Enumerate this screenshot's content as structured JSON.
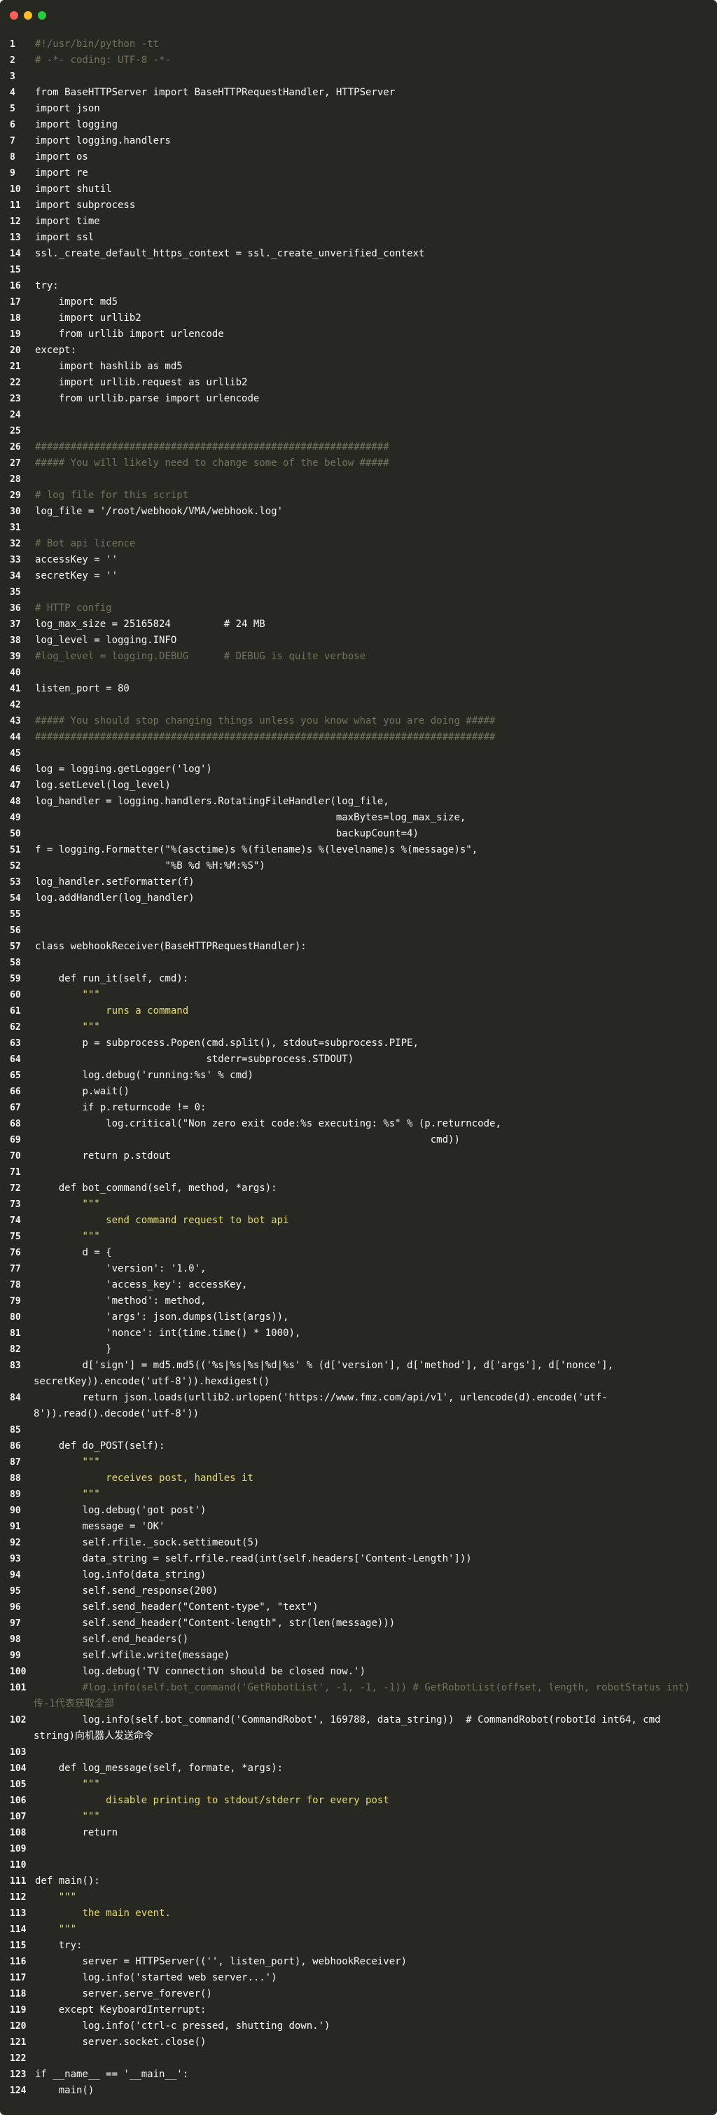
{
  "window": {
    "buttons": [
      "close",
      "minimize",
      "maximize"
    ]
  },
  "code": {
    "language": "python",
    "lines": [
      {
        "n": "1",
        "t": "#!/usr/bin/python -tt",
        "c": "cm"
      },
      {
        "n": "2",
        "t": "# -*- coding: UTF-8 -*-",
        "c": "cm"
      },
      {
        "n": "3",
        "t": "",
        "c": ""
      },
      {
        "n": "4",
        "t": "from BaseHTTPServer import BaseHTTPRequestHandler, HTTPServer",
        "c": ""
      },
      {
        "n": "5",
        "t": "import json",
        "c": ""
      },
      {
        "n": "6",
        "t": "import logging",
        "c": ""
      },
      {
        "n": "7",
        "t": "import logging.handlers",
        "c": ""
      },
      {
        "n": "8",
        "t": "import os",
        "c": ""
      },
      {
        "n": "9",
        "t": "import re",
        "c": ""
      },
      {
        "n": "10",
        "t": "import shutil",
        "c": ""
      },
      {
        "n": "11",
        "t": "import subprocess",
        "c": ""
      },
      {
        "n": "12",
        "t": "import time",
        "c": ""
      },
      {
        "n": "13",
        "t": "import ssl",
        "c": ""
      },
      {
        "n": "14",
        "t": "ssl._create_default_https_context = ssl._create_unverified_context",
        "c": ""
      },
      {
        "n": "15",
        "t": "",
        "c": ""
      },
      {
        "n": "16",
        "t": "try:",
        "c": ""
      },
      {
        "n": "17",
        "t": "    import md5",
        "c": ""
      },
      {
        "n": "18",
        "t": "    import urllib2",
        "c": ""
      },
      {
        "n": "19",
        "t": "    from urllib import urlencode",
        "c": ""
      },
      {
        "n": "20",
        "t": "except:",
        "c": ""
      },
      {
        "n": "21",
        "t": "    import hashlib as md5",
        "c": ""
      },
      {
        "n": "22",
        "t": "    import urllib.request as urllib2",
        "c": ""
      },
      {
        "n": "23",
        "t": "    from urllib.parse import urlencode",
        "c": ""
      },
      {
        "n": "24",
        "t": "",
        "c": ""
      },
      {
        "n": "25",
        "t": "",
        "c": ""
      },
      {
        "n": "26",
        "t": "############################################################",
        "c": "cm"
      },
      {
        "n": "27",
        "t": "##### You will likely need to change some of the below #####",
        "c": "cm"
      },
      {
        "n": "28",
        "t": "",
        "c": ""
      },
      {
        "n": "29",
        "t": "# log file for this script",
        "c": "cm"
      },
      {
        "n": "30",
        "t": "log_file = '/root/webhook/VMA/webhook.log'",
        "c": ""
      },
      {
        "n": "31",
        "t": "",
        "c": ""
      },
      {
        "n": "32",
        "t": "# Bot api licence",
        "c": "cm"
      },
      {
        "n": "33",
        "t": "accessKey = ''",
        "c": ""
      },
      {
        "n": "34",
        "t": "secretKey = ''",
        "c": ""
      },
      {
        "n": "35",
        "t": "",
        "c": ""
      },
      {
        "n": "36",
        "t": "# HTTP config",
        "c": "cm"
      },
      {
        "n": "37",
        "t": "log_max_size = 25165824         # 24 MB",
        "c": ""
      },
      {
        "n": "38",
        "t": "log_level = logging.INFO",
        "c": ""
      },
      {
        "n": "39",
        "t": "#log_level = logging.DEBUG      # DEBUG is quite verbose",
        "c": "cm"
      },
      {
        "n": "40",
        "t": "",
        "c": ""
      },
      {
        "n": "41",
        "t": "listen_port = 80",
        "c": ""
      },
      {
        "n": "42",
        "t": "",
        "c": ""
      },
      {
        "n": "43",
        "t": "##### You should stop changing things unless you know what you are doing #####",
        "c": "cm"
      },
      {
        "n": "44",
        "t": "##############################################################################",
        "c": "cm"
      },
      {
        "n": "45",
        "t": "",
        "c": ""
      },
      {
        "n": "46",
        "t": "log = logging.getLogger('log')",
        "c": ""
      },
      {
        "n": "47",
        "t": "log.setLevel(log_level)",
        "c": ""
      },
      {
        "n": "48",
        "t": "log_handler = logging.handlers.RotatingFileHandler(log_file,",
        "c": ""
      },
      {
        "n": "49",
        "t": "                                                   maxBytes=log_max_size,",
        "c": ""
      },
      {
        "n": "50",
        "t": "                                                   backupCount=4)",
        "c": ""
      },
      {
        "n": "51",
        "t": "f = logging.Formatter(\"%(asctime)s %(filename)s %(levelname)s %(message)s\",",
        "c": ""
      },
      {
        "n": "52",
        "t": "                      \"%B %d %H:%M:%S\")",
        "c": ""
      },
      {
        "n": "53",
        "t": "log_handler.setFormatter(f)",
        "c": ""
      },
      {
        "n": "54",
        "t": "log.addHandler(log_handler)",
        "c": ""
      },
      {
        "n": "55",
        "t": "",
        "c": ""
      },
      {
        "n": "56",
        "t": "",
        "c": ""
      },
      {
        "n": "57",
        "t": "class webhookReceiver(BaseHTTPRequestHandler):",
        "c": ""
      },
      {
        "n": "58",
        "t": "",
        "c": ""
      },
      {
        "n": "59",
        "t": "    def run_it(self, cmd):",
        "c": ""
      },
      {
        "n": "60",
        "t": "        \"\"\"",
        "c": "str"
      },
      {
        "n": "61",
        "t": "            runs a command",
        "c": "str"
      },
      {
        "n": "62",
        "t": "        \"\"\"",
        "c": "str"
      },
      {
        "n": "63",
        "t": "        p = subprocess.Popen(cmd.split(), stdout=subprocess.PIPE,",
        "c": ""
      },
      {
        "n": "64",
        "t": "                             stderr=subprocess.STDOUT)",
        "c": ""
      },
      {
        "n": "65",
        "t": "        log.debug('running:%s' % cmd)",
        "c": ""
      },
      {
        "n": "66",
        "t": "        p.wait()",
        "c": ""
      },
      {
        "n": "67",
        "t": "        if p.returncode != 0:",
        "c": ""
      },
      {
        "n": "68",
        "t": "            log.critical(\"Non zero exit code:%s executing: %s\" % (p.returncode,",
        "c": ""
      },
      {
        "n": "69",
        "t": "                                                                   cmd))",
        "c": ""
      },
      {
        "n": "70",
        "t": "        return p.stdout",
        "c": ""
      },
      {
        "n": "71",
        "t": "",
        "c": ""
      },
      {
        "n": "72",
        "t": "    def bot_command(self, method, *args):",
        "c": ""
      },
      {
        "n": "73",
        "t": "        \"\"\"",
        "c": "str"
      },
      {
        "n": "74",
        "t": "            send command request to bot api",
        "c": "str"
      },
      {
        "n": "75",
        "t": "        \"\"\"",
        "c": "str"
      },
      {
        "n": "76",
        "t": "        d = {",
        "c": ""
      },
      {
        "n": "77",
        "t": "            'version': '1.0',",
        "c": ""
      },
      {
        "n": "78",
        "t": "            'access_key': accessKey,",
        "c": ""
      },
      {
        "n": "79",
        "t": "            'method': method,",
        "c": ""
      },
      {
        "n": "80",
        "t": "            'args': json.dumps(list(args)),",
        "c": ""
      },
      {
        "n": "81",
        "t": "            'nonce': int(time.time() * 1000),",
        "c": ""
      },
      {
        "n": "82",
        "t": "            }",
        "c": ""
      },
      {
        "n": "83",
        "t": "        d['sign'] = md5.md5(('%s|%s|%s|%d|%s' % (d['version'], d['method'], d['args'], d['nonce'],",
        "c": "",
        "w": "secretKey)).encode('utf-8')).hexdigest()"
      },
      {
        "n": "84",
        "t": "        return json.loads(urllib2.urlopen('https://www.fmz.com/api/v1', urlencode(d).encode('utf-",
        "c": "",
        "w": "8')).read().decode('utf-8'))"
      },
      {
        "n": "85",
        "t": "",
        "c": ""
      },
      {
        "n": "86",
        "t": "    def do_POST(self):",
        "c": ""
      },
      {
        "n": "87",
        "t": "        \"\"\"",
        "c": "str"
      },
      {
        "n": "88",
        "t": "            receives post, handles it",
        "c": "str"
      },
      {
        "n": "89",
        "t": "        \"\"\"",
        "c": "str"
      },
      {
        "n": "90",
        "t": "        log.debug('got post')",
        "c": ""
      },
      {
        "n": "91",
        "t": "        message = 'OK'",
        "c": ""
      },
      {
        "n": "92",
        "t": "        self.rfile._sock.settimeout(5)",
        "c": ""
      },
      {
        "n": "93",
        "t": "        data_string = self.rfile.read(int(self.headers['Content-Length']))",
        "c": ""
      },
      {
        "n": "94",
        "t": "        log.info(data_string)",
        "c": ""
      },
      {
        "n": "95",
        "t": "        self.send_response(200)",
        "c": ""
      },
      {
        "n": "96",
        "t": "        self.send_header(\"Content-type\", \"text\")",
        "c": ""
      },
      {
        "n": "97",
        "t": "        self.send_header(\"Content-length\", str(len(message)))",
        "c": ""
      },
      {
        "n": "98",
        "t": "        self.end_headers()",
        "c": ""
      },
      {
        "n": "99",
        "t": "        self.wfile.write(message)",
        "c": ""
      },
      {
        "n": "100",
        "t": "        log.debug('TV connection should be closed now.')",
        "c": ""
      },
      {
        "n": "101",
        "t": "        #log.info(self.bot_command('GetRobotList', -1, -1, -1)) # GetRobotList(offset, length, robotStatus int)",
        "c": "cm",
        "w": "传-1代表获取全部"
      },
      {
        "n": "102",
        "t": "        log.info(self.bot_command('CommandRobot', 169788, data_string))  # CommandRobot(robotId int64, cmd",
        "c": "",
        "w": "string)向机器人发送命令"
      },
      {
        "n": "103",
        "t": "",
        "c": ""
      },
      {
        "n": "104",
        "t": "    def log_message(self, formate, *args):",
        "c": ""
      },
      {
        "n": "105",
        "t": "        \"\"\"",
        "c": "str"
      },
      {
        "n": "106",
        "t": "            disable printing to stdout/stderr for every post",
        "c": "str"
      },
      {
        "n": "107",
        "t": "        \"\"\"",
        "c": "str"
      },
      {
        "n": "108",
        "t": "        return",
        "c": ""
      },
      {
        "n": "109",
        "t": "",
        "c": ""
      },
      {
        "n": "110",
        "t": "",
        "c": ""
      },
      {
        "n": "111",
        "t": "def main():",
        "c": ""
      },
      {
        "n": "112",
        "t": "    \"\"\"",
        "c": "str"
      },
      {
        "n": "113",
        "t": "        the main event.",
        "c": "str"
      },
      {
        "n": "114",
        "t": "    \"\"\"",
        "c": "str"
      },
      {
        "n": "115",
        "t": "    try:",
        "c": ""
      },
      {
        "n": "116",
        "t": "        server = HTTPServer(('', listen_port), webhookReceiver)",
        "c": ""
      },
      {
        "n": "117",
        "t": "        log.info('started web server...')",
        "c": ""
      },
      {
        "n": "118",
        "t": "        server.serve_forever()",
        "c": ""
      },
      {
        "n": "119",
        "t": "    except KeyboardInterrupt:",
        "c": ""
      },
      {
        "n": "120",
        "t": "        log.info('ctrl-c pressed, shutting down.')",
        "c": ""
      },
      {
        "n": "121",
        "t": "        server.socket.close()",
        "c": ""
      },
      {
        "n": "122",
        "t": "",
        "c": ""
      },
      {
        "n": "123",
        "t": "if __name__ == '__main__':",
        "c": ""
      },
      {
        "n": "124",
        "t": "    main()",
        "c": ""
      }
    ]
  }
}
